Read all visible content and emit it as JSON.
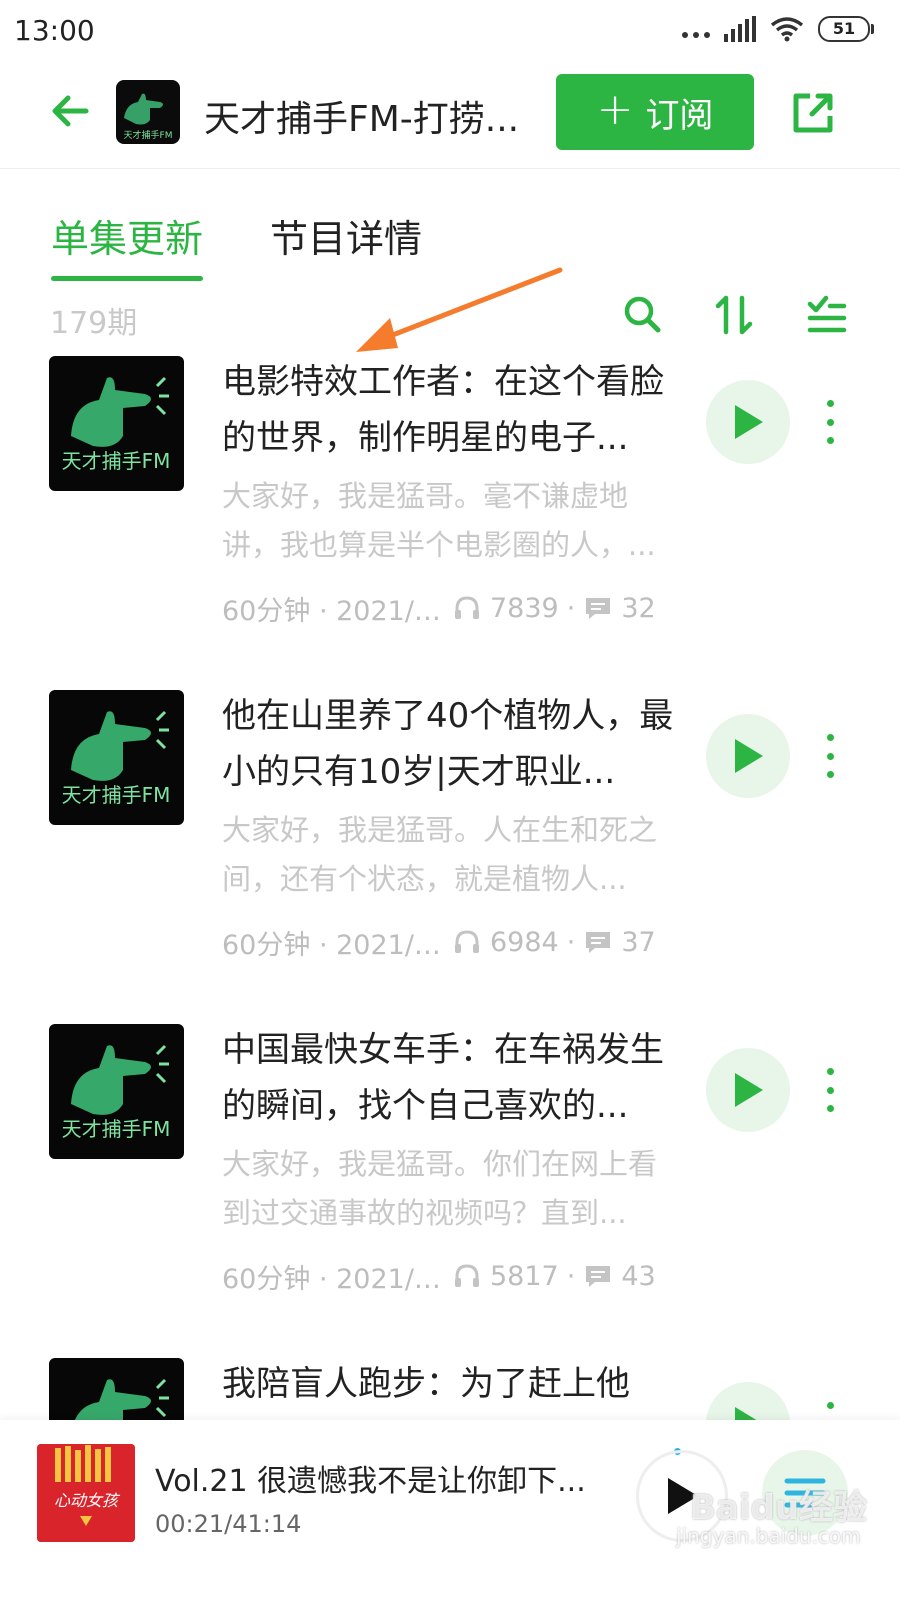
{
  "status_bar": {
    "time": "13:00",
    "battery": "51"
  },
  "header": {
    "title": "天才捕手FM-打捞...",
    "subscribe_label": "订阅",
    "logo_text": "天才捕手FM"
  },
  "tabs": [
    {
      "label": "单集更新",
      "active": true
    },
    {
      "label": "节目详情",
      "active": false
    }
  ],
  "toolbar": {
    "episode_count": "179期"
  },
  "episodes": [
    {
      "title": "电影特效工作者：在这个看脸的世界，制作明星的电子...",
      "desc": "大家好，我是猛哥。毫不谦虚地讲，我也算是半个电影圈的人，...",
      "duration_date": "60分钟 · 2021/1...",
      "plays": "7839",
      "comments": "32"
    },
    {
      "title": "他在山里养了40个植物人，最小的只有10岁|天才职业...",
      "desc": "大家好，我是猛哥。人在生和死之间，还有个状态，就是植物人...",
      "duration_date": "60分钟 · 2021/1...",
      "plays": "6984",
      "comments": "37"
    },
    {
      "title": "中国最快女车手：在车祸发生的瞬间，找个自己喜欢的...",
      "desc": "大家好，我是猛哥。你们在网上看到过交通事故的视频吗？直到...",
      "duration_date": "60分钟 · 2021/1...",
      "plays": "5817",
      "comments": "43"
    },
    {
      "title": "我陪盲人跑步：为了赶上他",
      "desc": "",
      "duration_date": "",
      "plays": "",
      "comments": ""
    }
  ],
  "player": {
    "title": "Vol.21 很遗憾我不是让你卸下...",
    "time": "00:21/41:14",
    "cover_text": "心动女孩"
  },
  "watermark": {
    "main": "Baidu经验",
    "sub": "jingyan.baidu.com"
  },
  "colors": {
    "accent": "#2db543",
    "annotation": "#f47c2c"
  }
}
